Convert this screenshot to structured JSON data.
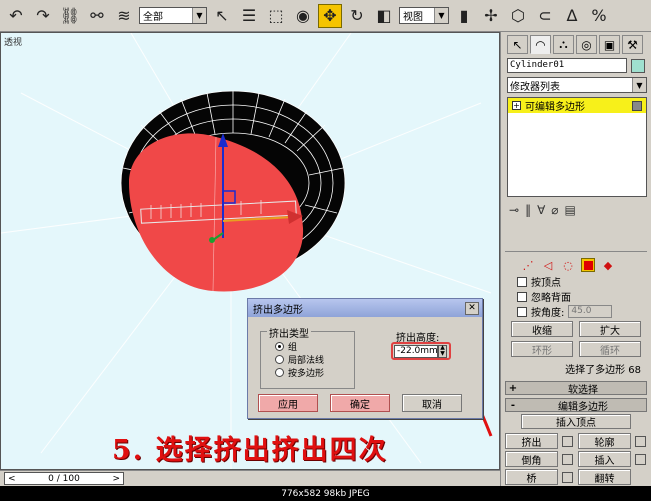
{
  "toolbar": {
    "selection_filter": "全部",
    "coordinate_system": "视图",
    "icons": [
      "undo-icon",
      "redo-icon",
      "link-icon",
      "unlink-icon",
      "bind-space-warp-icon",
      "select-icon",
      "select-by-name-icon",
      "region-select-icon",
      "window-crossing-icon",
      "move-icon",
      "rotate-icon",
      "scale-icon",
      "pivot-icon",
      "mirror-icon",
      "align-icon",
      "snap-icon",
      "angle-snap-icon",
      "percent-snap-icon"
    ]
  },
  "viewport": {
    "label": "透视",
    "sphere_color": "#f04848",
    "background": "#e4f7fb"
  },
  "panel": {
    "tabs": [
      "create-tab",
      "modify-tab",
      "hierarchy-tab",
      "motion-tab",
      "display-tab",
      "utilities-tab"
    ],
    "object_name": "Cylinder01",
    "object_color": "#9fe0cf",
    "modifier_list": "修改器列表",
    "stack_item": "可编辑多边形",
    "selection": {
      "by_vertex": "按顶点",
      "ignore_backfacing": "忽略背面",
      "by_angle": "按角度:",
      "angle_value": "45.0",
      "shrink": "收缩",
      "grow": "扩大",
      "ring": "环形",
      "loop": "循环",
      "status": "选择了多边形 68"
    },
    "rollouts": {
      "soft_selection": "软选择",
      "edit_polygons": "编辑多边形"
    },
    "edit": {
      "insert_vertex": "插入顶点",
      "extrude": "挤出",
      "outline": "轮廓",
      "bevel": "倒角",
      "inset": "插入",
      "bridge": "桥",
      "flip": "翻转"
    }
  },
  "dialog": {
    "title": "挤出多边形",
    "extrusion_type_label": "挤出类型",
    "options": [
      "组",
      "局部法线",
      "按多边形"
    ],
    "selected_option": "组",
    "height_label": "挤出高度:",
    "height_value": "-22.0mm",
    "apply": "应用",
    "ok": "确定",
    "cancel": "取消"
  },
  "caption": "5. 选择挤出挤出四次",
  "status": {
    "frame": "0 / 100"
  },
  "image_info": "776x582  98kb  JPEG"
}
